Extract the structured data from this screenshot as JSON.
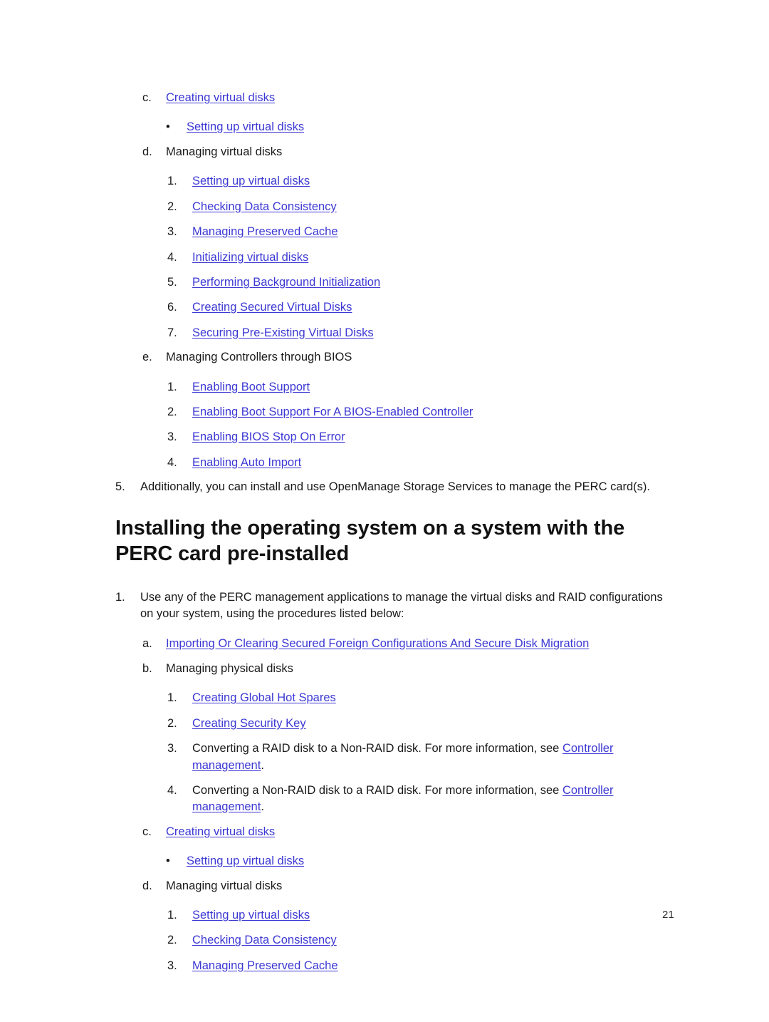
{
  "document": {
    "page_number": "21",
    "link_color": "#3c38d4",
    "text_color": "#1a1a1a"
  },
  "top_block": {
    "item_c": {
      "marker": "c.",
      "label": "Creating virtual disks",
      "is_link": true
    },
    "bullet_1": {
      "marker": "•",
      "label": "Setting up virtual disks",
      "is_link": true
    },
    "item_d": {
      "marker": "d.",
      "label": "Managing virtual disks",
      "is_link": false
    },
    "d_sublist": [
      {
        "marker": "1.",
        "label": "Setting up virtual disks"
      },
      {
        "marker": "2.",
        "label": "Checking Data Consistency"
      },
      {
        "marker": "3.",
        "label": "Managing Preserved Cache"
      },
      {
        "marker": "4.",
        "label": "Initializing virtual disks"
      },
      {
        "marker": "5.",
        "label": "Performing Background Initialization"
      },
      {
        "marker": "6.",
        "label": "Creating Secured Virtual Disks"
      },
      {
        "marker": "7.",
        "label": "Securing Pre-Existing Virtual Disks"
      }
    ],
    "item_e": {
      "marker": "e.",
      "label": "Managing Controllers through BIOS",
      "is_link": false
    },
    "e_sublist": [
      {
        "marker": "1.",
        "label": "Enabling Boot Support"
      },
      {
        "marker": "2.",
        "label": "Enabling Boot Support For A BIOS-Enabled Controller"
      },
      {
        "marker": "3.",
        "label": "Enabling BIOS Stop On Error"
      },
      {
        "marker": "4.",
        "label": "Enabling Auto Import"
      }
    ],
    "item_5": {
      "marker": "5.",
      "text": "Additionally, you can install and use OpenManage Storage Services to manage the PERC card(s)."
    }
  },
  "heading": {
    "text": "Installing the operating system on a system with the PERC card pre-installed"
  },
  "bottom_block": {
    "item_1": {
      "marker": "1.",
      "text": "Use any of the PERC management applications to manage the virtual disks and RAID configurations on your system, using the procedures listed below:"
    },
    "item_a": {
      "marker": "a.",
      "label": "Importing Or Clearing Secured Foreign Configurations And Secure Disk Migration",
      "is_link": true
    },
    "item_b": {
      "marker": "b.",
      "label": "Managing physical disks",
      "is_link": false
    },
    "b_sublist": [
      {
        "marker": "1.",
        "label": "Creating Global Hot Spares",
        "type": "link"
      },
      {
        "marker": "2.",
        "label": "Creating Security Key",
        "type": "link"
      },
      {
        "marker": "3.",
        "type": "mixed",
        "text_before": "Converting a RAID disk to a Non-RAID disk. For more information, see ",
        "link_text": "Controller management",
        "text_after": "."
      },
      {
        "marker": "4.",
        "type": "mixed",
        "text_before": "Converting a Non-RAID disk to a RAID disk. For more information, see ",
        "link_text": "Controller management",
        "text_after": "."
      }
    ],
    "item_c": {
      "marker": "c.",
      "label": "Creating virtual disks",
      "is_link": true
    },
    "bullet_1": {
      "marker": "•",
      "label": "Setting up virtual disks",
      "is_link": true
    },
    "item_d": {
      "marker": "d.",
      "label": "Managing virtual disks",
      "is_link": false
    },
    "d_sublist": [
      {
        "marker": "1.",
        "label": "Setting up virtual disks"
      },
      {
        "marker": "2.",
        "label": "Checking Data Consistency"
      },
      {
        "marker": "3.",
        "label": "Managing Preserved Cache"
      }
    ]
  }
}
